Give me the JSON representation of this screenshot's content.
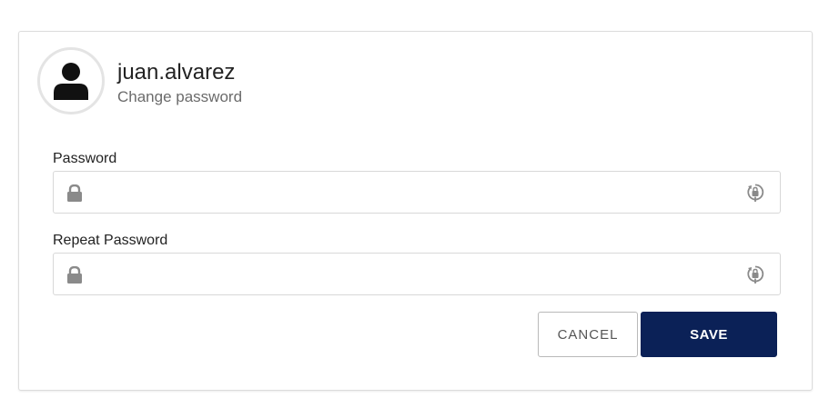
{
  "profile": {
    "username": "juan.alvarez",
    "subtitle": "Change password",
    "avatar_icon": "user-icon"
  },
  "form": {
    "password": {
      "label": "Password",
      "value": "",
      "placeholder": "",
      "leading_icon": "lock-icon",
      "trailing_icon": "reveal-password-icon"
    },
    "repeat_password": {
      "label": "Repeat Password",
      "value": "",
      "placeholder": "",
      "leading_icon": "lock-icon",
      "trailing_icon": "reveal-password-icon"
    }
  },
  "actions": {
    "cancel_label": "CANCEL",
    "save_label": "SAVE"
  },
  "colors": {
    "primary": "#0b2157",
    "border": "#d8d8d8",
    "icon": "#8a8a8a",
    "subtitle": "#6b6b6b"
  }
}
